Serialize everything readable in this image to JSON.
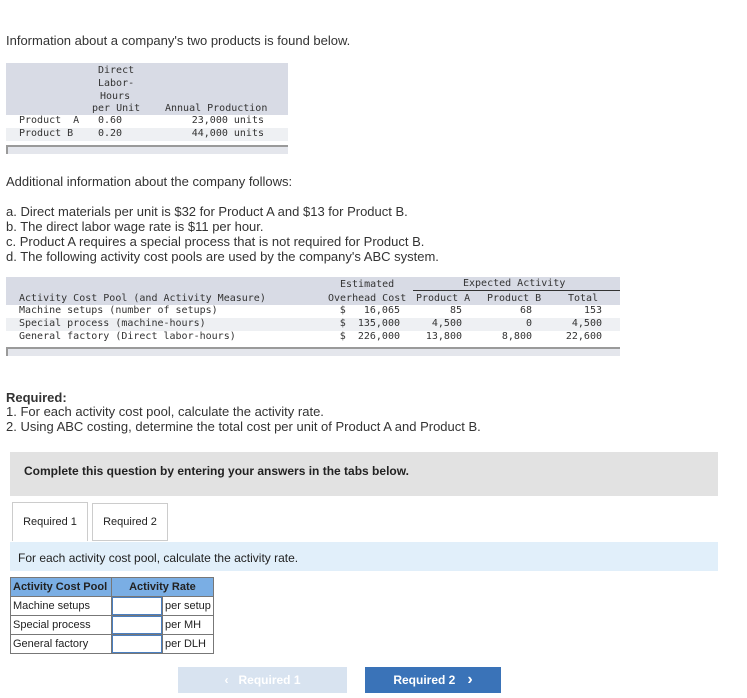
{
  "intro": "Information about a company's two products is found below.",
  "table1": {
    "headers": [
      "Direct",
      "Labor-",
      "Hours",
      "per Unit"
    ],
    "annual_header": "Annual Production",
    "rows": [
      {
        "product": "Product  A",
        "dlh": "0.60",
        "annual": "23,000 units"
      },
      {
        "product": "Product B",
        "dlh": "0.20",
        "annual": "44,000 units"
      }
    ]
  },
  "additional": "Additional information about the company follows:",
  "items": [
    "a. Direct materials per unit is $32 for Product A and $13 for Product B.",
    "b. The direct labor wage rate is $11 per hour.",
    "c. Product A requires a special process that is not required for Product B.",
    "d. The following activity cost pools are used by the company's ABC system."
  ],
  "table2": {
    "h_estimated": "Estimated",
    "h_expected": "Expected Activity",
    "h_pool": "Activity Cost Pool (and Activity Measure)",
    "h_overhead": "Overhead Cost",
    "h_a": "Product A",
    "h_b": "Product B",
    "h_total": "Total",
    "rows": [
      {
        "pool": "Machine setups (number of setups)",
        "cost": "$   16,065",
        "a": "85",
        "b": "68",
        "total": "153"
      },
      {
        "pool": "Special process (machine-hours)",
        "cost": "$  135,000",
        "a": "4,500",
        "b": "0",
        "total": "4,500"
      },
      {
        "pool": "General factory (Direct labor-hours)",
        "cost": "$  226,000",
        "a": "13,800",
        "b": "8,800",
        "total": "22,600"
      }
    ]
  },
  "required_title": "Required:",
  "required": [
    "1. For each activity cost pool, calculate the activity rate.",
    "2. Using ABC costing, determine the total cost per unit of Product A and Product B."
  ],
  "complete": "Complete this question by entering your answers in the tabs below.",
  "tabs": [
    "Required 1",
    "Required 2"
  ],
  "instruction": "For each activity cost pool, calculate the activity rate.",
  "answer": {
    "h_pool": "Activity Cost Pool",
    "h_rate": "Activity Rate",
    "rows": [
      {
        "pool": "Machine setups",
        "value": "",
        "unit": "per setup"
      },
      {
        "pool": "Special process",
        "value": "",
        "unit": "per MH"
      },
      {
        "pool": "General factory",
        "value": "",
        "unit": "per DLH"
      }
    ]
  },
  "nav": {
    "prev": "Required 1",
    "next": "Required 2"
  },
  "colors": {
    "accent": "#3a73b8",
    "disabled": "#d8e3f0"
  }
}
